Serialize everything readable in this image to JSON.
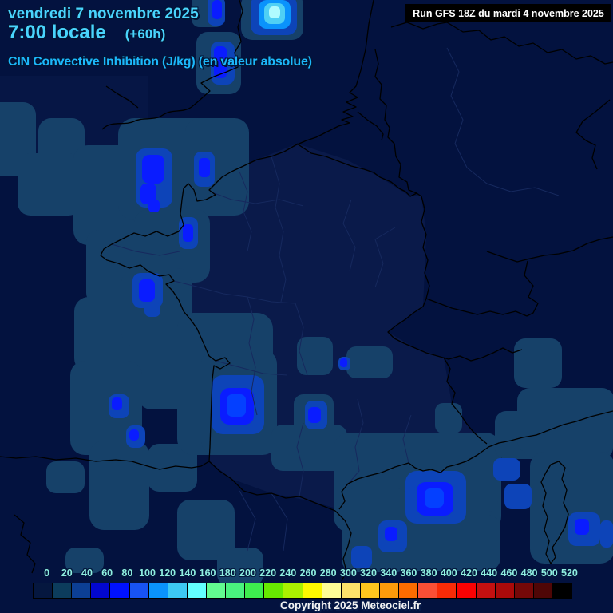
{
  "header": {
    "date_line": "vendredi 7 novembre 2025",
    "time_line": "7:00 locale",
    "offset": "(+60h)",
    "subtitle": "CIN Convective Inhibition (J/kg) (en valeur absolue)",
    "run_info": "Run GFS 18Z du mardi 4 novembre 2025"
  },
  "footer": {
    "copyright": "Copyright 2025 Meteociel.fr"
  },
  "colors": {
    "background": "#03123f",
    "title_text": "#49d4fc",
    "subtitle_text": "#1cb8fb",
    "scale_label_text": "#8feee0",
    "run_box_bg": "#000000",
    "run_box_text": "#ffffff"
  },
  "scale": {
    "unit": "J/kg",
    "values": [
      "0",
      "20",
      "40",
      "60",
      "80",
      "100",
      "120",
      "140",
      "160",
      "180",
      "200",
      "220",
      "240",
      "260",
      "280",
      "300",
      "320",
      "340",
      "360",
      "380",
      "400",
      "420",
      "440",
      "460",
      "480",
      "500",
      "520"
    ],
    "colors": [
      "#05173f",
      "#0c3c5c",
      "#0c3f94",
      "#0207cf",
      "#0011ff",
      "#1853f2",
      "#0a93fc",
      "#3dc9f2",
      "#63ffff",
      "#62fb90",
      "#49f27e",
      "#3eee4e",
      "#67e900",
      "#aaf000",
      "#fdf800",
      "#fdfd96",
      "#fce26a",
      "#fdc41e",
      "#fc9b0b",
      "#fc6c00",
      "#fb4f35",
      "#f92b07",
      "#fa0203",
      "#c41010",
      "#aa0a0a",
      "#750808",
      "#4f0606",
      "#000000"
    ]
  }
}
